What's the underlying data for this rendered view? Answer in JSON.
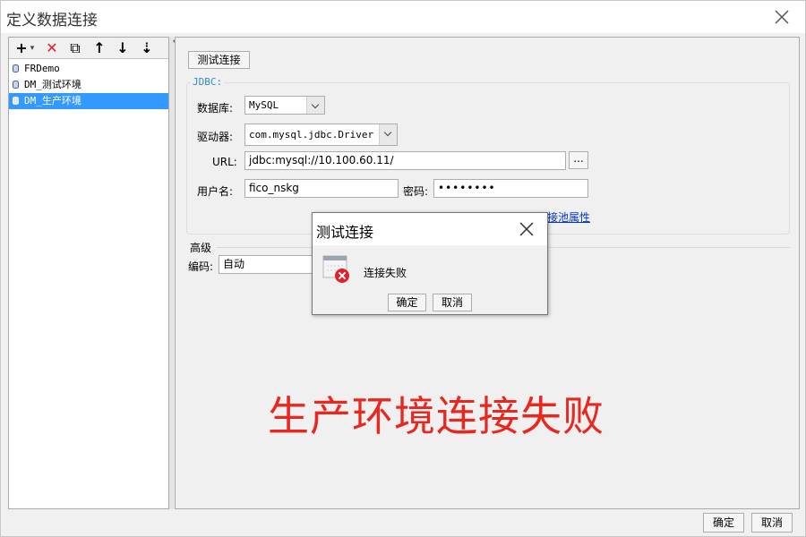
{
  "window": {
    "title": "定义数据连接"
  },
  "toolbar": {
    "add_label": "+",
    "add_dropdown": "▾",
    "delete_label": "✕",
    "copy_label": "⧉",
    "up_label": "↑",
    "down_label": "↓",
    "sort_label": "⇣"
  },
  "tree": {
    "items": [
      {
        "label": "FRDemo"
      },
      {
        "label": "DM_测试环境"
      },
      {
        "label": "DM_生产环境"
      }
    ]
  },
  "form": {
    "test_button": "测试连接",
    "jdbc_legend": "JDBC:",
    "database_label": "数据库:",
    "database_value": "MySQL",
    "driver_label": "驱动器:",
    "driver_value": "com.mysql.jdbc.Driver",
    "url_label": "URL:",
    "url_value": "jdbc:mysql://10.100.60.11/",
    "url_ellipsis": "...",
    "username_label": "用户名:",
    "username_value": "fico_nskg",
    "password_label": "密码:",
    "password_value": "••••••••",
    "pool_link": "连接池属性",
    "advanced_label": "高级",
    "encoding_label": "编码:",
    "encoding_value": "自动"
  },
  "annotation": {
    "text": "生产环境连接失败",
    "color": "#e8271f"
  },
  "footer": {
    "ok_label": "确定",
    "cancel_label": "取消"
  },
  "modal": {
    "title": "测试连接",
    "message": "连接失败",
    "ok_label": "确定",
    "cancel_label": "取消",
    "icon": "error-icon"
  },
  "colors": {
    "selection": "#3399ff",
    "link": "#0033cc",
    "legend": "#2e8bc0",
    "error": "#e0202a"
  }
}
